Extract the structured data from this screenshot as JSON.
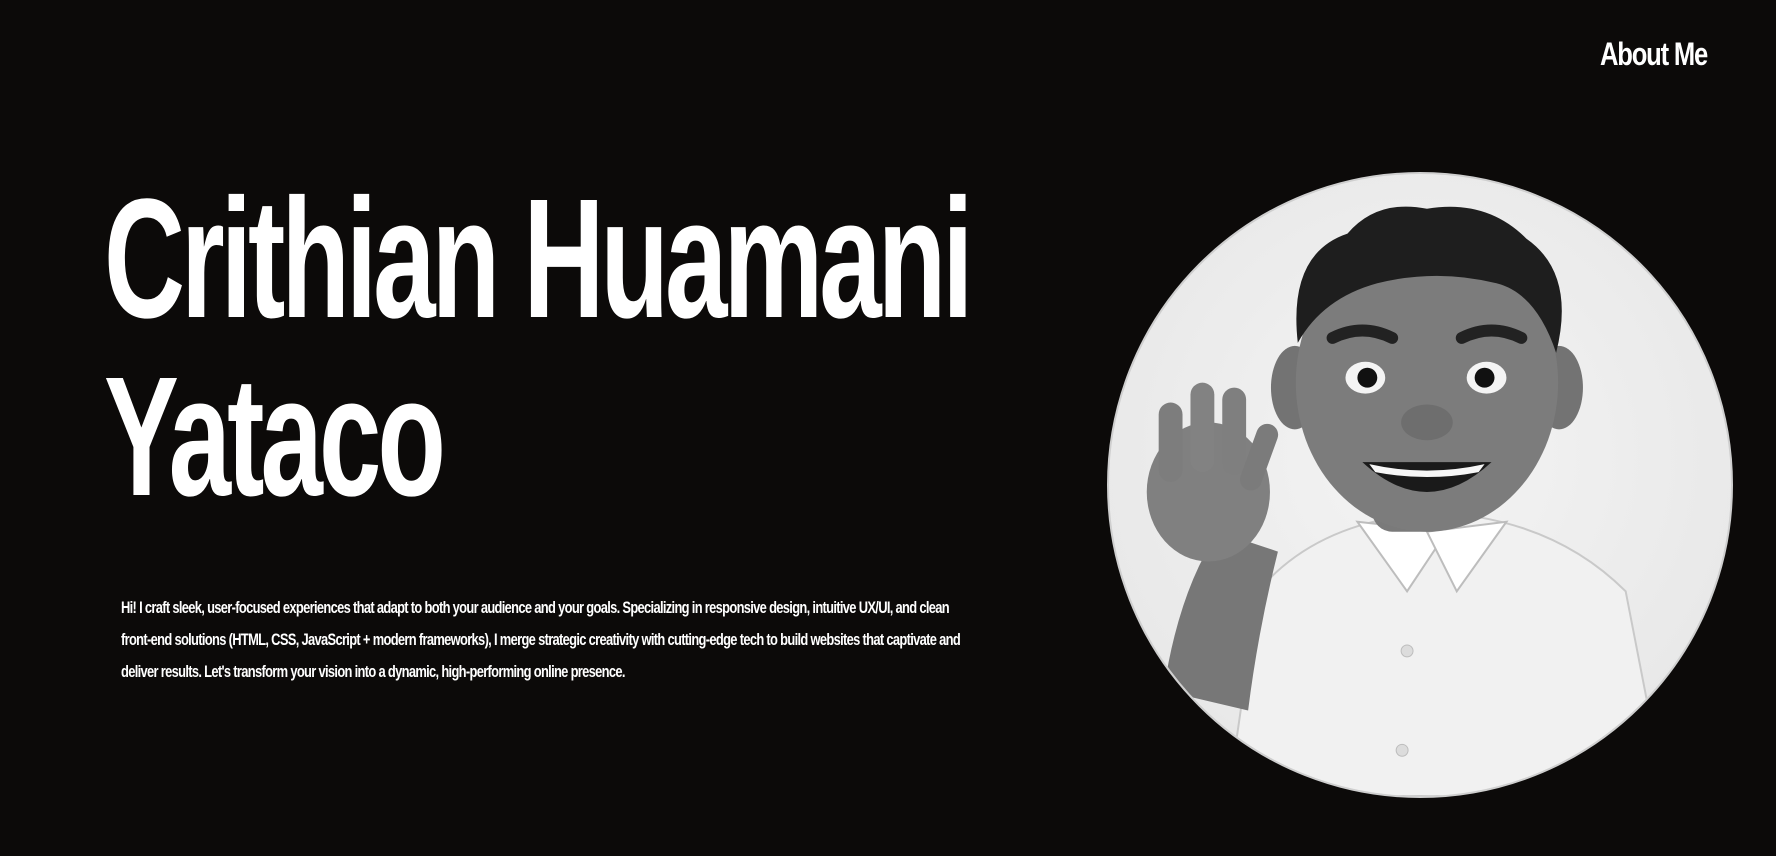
{
  "nav": {
    "about_label": "About Me"
  },
  "hero": {
    "name_line1": "Crithian Huamani",
    "name_line2": "Yataco",
    "intro": "Hi! I craft sleek, user-focused experiences that adapt to both your audience and your goals. Specializing in responsive design, intuitive UX/UI, and clean front-end solutions (HTML, CSS, JavaScript + modern frameworks), I merge strategic creativity with cutting-edge tech to build websites that captivate and deliver results. Let's transform your vision into a dynamic, high-performing online presence."
  },
  "avatar": {
    "icon": "waving-cartoon-avatar-icon"
  },
  "colors": {
    "background": "#0c0a09",
    "text": "#ffffff",
    "avatar_bg": "#ececec"
  }
}
